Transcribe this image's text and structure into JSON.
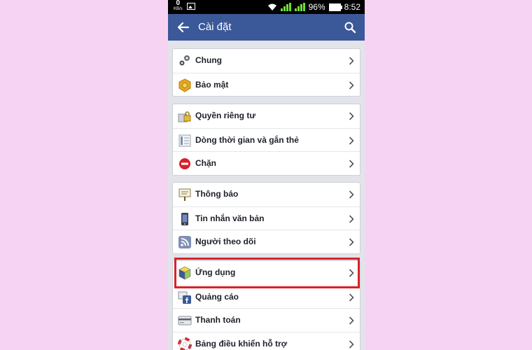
{
  "status_bar": {
    "speed_value": "0",
    "speed_unit": "KB/s",
    "battery": "96%",
    "time": "8:52"
  },
  "app_bar": {
    "title": "Cài đặt"
  },
  "groups": [
    {
      "items": [
        {
          "label": "Chung",
          "icon": "gears-icon"
        },
        {
          "label": "Bảo mật",
          "icon": "security-badge-icon"
        }
      ]
    },
    {
      "items": [
        {
          "label": "Quyền riêng tư",
          "icon": "privacy-lock-icon"
        },
        {
          "label": "Dòng thời gian và gắn thẻ",
          "icon": "timeline-icon"
        },
        {
          "label": "Chặn",
          "icon": "block-icon"
        }
      ]
    },
    {
      "items": [
        {
          "label": "Thông báo",
          "icon": "notification-board-icon"
        },
        {
          "label": "Tin nhắn văn bản",
          "icon": "mobile-phone-icon"
        },
        {
          "label": "Người theo dõi",
          "icon": "rss-feed-icon"
        }
      ]
    },
    {
      "items": [
        {
          "label": "Ứng dụng",
          "icon": "app-cube-icon"
        },
        {
          "label": "Quảng cáo",
          "icon": "ads-icon"
        },
        {
          "label": "Thanh toán",
          "icon": "credit-card-icon"
        },
        {
          "label": "Bảng điều khiển hỗ trợ",
          "icon": "lifebuoy-icon"
        }
      ]
    }
  ],
  "colors": {
    "background": "#f6d3f3",
    "app_bar": "#3b5998",
    "highlight": "#d8222a"
  }
}
